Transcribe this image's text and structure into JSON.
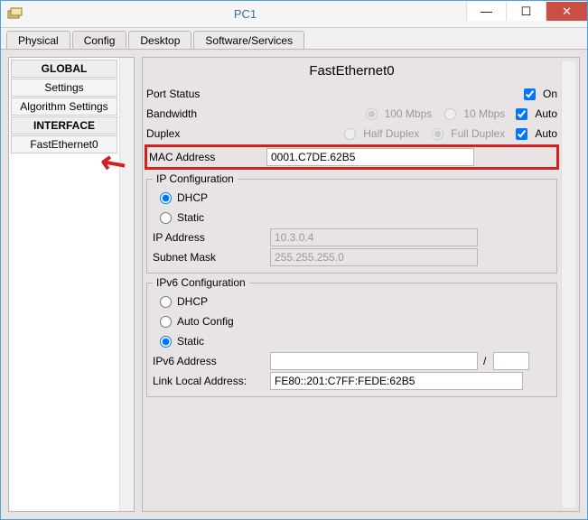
{
  "window": {
    "title": "PC1"
  },
  "tabs": {
    "physical": "Physical",
    "config": "Config",
    "desktop": "Desktop",
    "software": "Software/Services"
  },
  "sidebar": {
    "global_header": "GLOBAL",
    "settings": "Settings",
    "algorithm": "Algorithm Settings",
    "interface_header": "INTERFACE",
    "fe0": "FastEthernet0"
  },
  "panel": {
    "title": "FastEthernet0",
    "port_status_label": "Port Status",
    "port_status_on": "On",
    "bandwidth_label": "Bandwidth",
    "bw_100": "100 Mbps",
    "bw_10": "10 Mbps",
    "bw_auto": "Auto",
    "duplex_label": "Duplex",
    "dup_half": "Half Duplex",
    "dup_full": "Full Duplex",
    "dup_auto": "Auto",
    "mac_label": "MAC Address",
    "mac_value": "0001.C7DE.62B5",
    "ipconf_legend": "IP Configuration",
    "dhcp": "DHCP",
    "static": "Static",
    "ipaddr_label": "IP Address",
    "ipaddr_value": "10.3.0.4",
    "subnet_label": "Subnet Mask",
    "subnet_value": "255.255.255.0",
    "ipv6conf_legend": "IPv6 Configuration",
    "ipv6_dhcp": "DHCP",
    "ipv6_auto": "Auto Config",
    "ipv6_static": "Static",
    "ipv6addr_label": "IPv6 Address",
    "ipv6addr_value": "",
    "ipv6_prefix_slash": "/",
    "ipv6_prefix_value": "",
    "linklocal_label": "Link Local Address:",
    "linklocal_value": "FE80::201:C7FF:FEDE:62B5"
  }
}
